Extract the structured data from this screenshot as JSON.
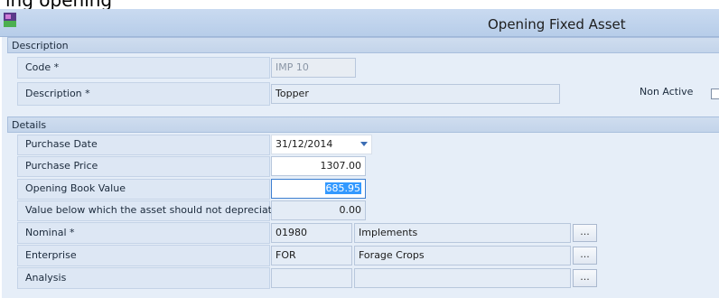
{
  "top_strip_text": "ing opening",
  "window": {
    "title": "Opening Fixed Asset"
  },
  "description_section": {
    "header": "Description",
    "code": {
      "label": "Code *",
      "value": "IMP 10"
    },
    "description": {
      "label": "Description *",
      "value": "Topper"
    },
    "non_active": {
      "label": "Non Active",
      "checked": false
    }
  },
  "details_section": {
    "header": "Details",
    "purchase_date": {
      "label": "Purchase Date",
      "value": "31/12/2014"
    },
    "purchase_price": {
      "label": "Purchase Price",
      "value": "1307.00"
    },
    "opening_book_value": {
      "label": "Opening Book Value",
      "value": "685.95"
    },
    "min_value": {
      "label": "Value below which the asset should not depreciate",
      "value": "0.00"
    },
    "nominal": {
      "label": "Nominal *",
      "code": "01980",
      "name": "Implements",
      "button": "..."
    },
    "enterprise": {
      "label": "Enterprise",
      "code": "FOR",
      "name": "Forage Crops",
      "button": "..."
    },
    "analysis": {
      "label": "Analysis",
      "code": "",
      "name": "",
      "button": "..."
    }
  }
}
